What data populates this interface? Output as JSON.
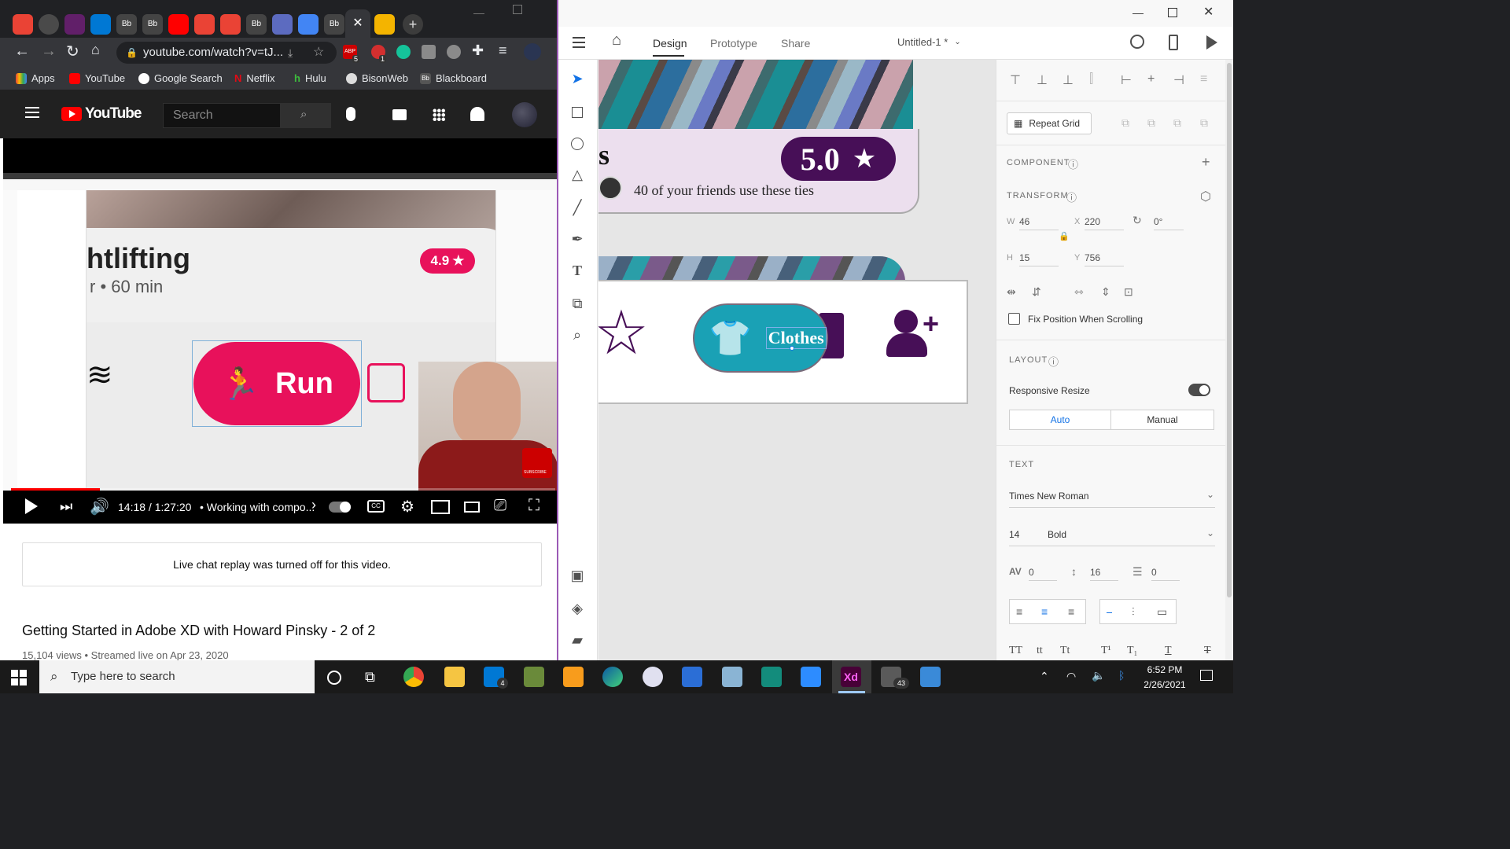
{
  "chrome": {
    "url": "youtube.com/watch?v=tJ...",
    "bookmarks": [
      "Apps",
      "YouTube",
      "Google Search",
      "Netflix",
      "Hulu",
      "BisonWeb",
      "Blackboard"
    ],
    "ext_badges": {
      "abp": "5",
      "red": "1"
    },
    "tab_icons": [
      "gmail-icon",
      "globe-icon",
      "slack-icon",
      "outlook-icon",
      "blackboard-icon",
      "blackboard-icon",
      "youtube-icon",
      "gmail-icon",
      "gmail-icon",
      "blackboard-icon",
      "tasks-icon",
      "docs-icon",
      "blackboard-icon",
      "close-icon",
      "slides-icon"
    ]
  },
  "youtube": {
    "logo": "YouTube",
    "search_placeholder": "Search",
    "time": "14:18 / 1:27:20",
    "chapter": "• Working with compo...",
    "live_chat": "Live chat replay was turned off for this video.",
    "title": "Getting Started in Adobe XD with Howard Pinsky - 2 of 2",
    "meta": "15,104 views • Streamed live on Apr 23, 2020",
    "progress_fraction": 0.164
  },
  "video_frame": {
    "heading": "htlifting",
    "subheading": "r • 60 min",
    "rating": "4.9",
    "button": "Run",
    "subscribe": "SUBSCRIBE"
  },
  "xd": {
    "tabs": {
      "design": "Design",
      "prototype": "Prototype",
      "share": "Share"
    },
    "doc_title": "Untitled-1 *",
    "canvas": {
      "card_letter": "s",
      "rating": "5.0",
      "friends_text": "40 of your friends use these ties",
      "clothes_label": "Clothes"
    },
    "panel": {
      "repeat_grid": "Repeat Grid",
      "component": "COMPONENT",
      "transform": "TRANSFORM",
      "w_label": "W",
      "w": "46",
      "h_label": "H",
      "h": "15",
      "x_label": "X",
      "x": "220",
      "y_label": "Y",
      "y": "756",
      "rotation": "0°",
      "fix_position": "Fix Position When Scrolling",
      "layout": "LAYOUT",
      "responsive_resize": "Responsive Resize",
      "auto": "Auto",
      "manual": "Manual",
      "text": "TEXT",
      "font_family": "Times New Roman",
      "font_size": "14",
      "font_weight": "Bold",
      "char_spacing": "0",
      "line_spacing": "16",
      "para_spacing": "0",
      "case_buttons": [
        "TT",
        "tt",
        "Tt",
        "T¹",
        "T₁",
        "T",
        "T"
      ]
    }
  },
  "taskbar": {
    "search_placeholder": "Type here to search",
    "time": "6:52 PM",
    "date": "2/26/2021",
    "mail_badge": "4",
    "teams_badge": "43",
    "xd_label": "Xd"
  },
  "colors": {
    "xd_accent": "#1473e6",
    "purple": "#470f57",
    "teal": "#1aa1b5",
    "run_pink": "#e8115b"
  }
}
